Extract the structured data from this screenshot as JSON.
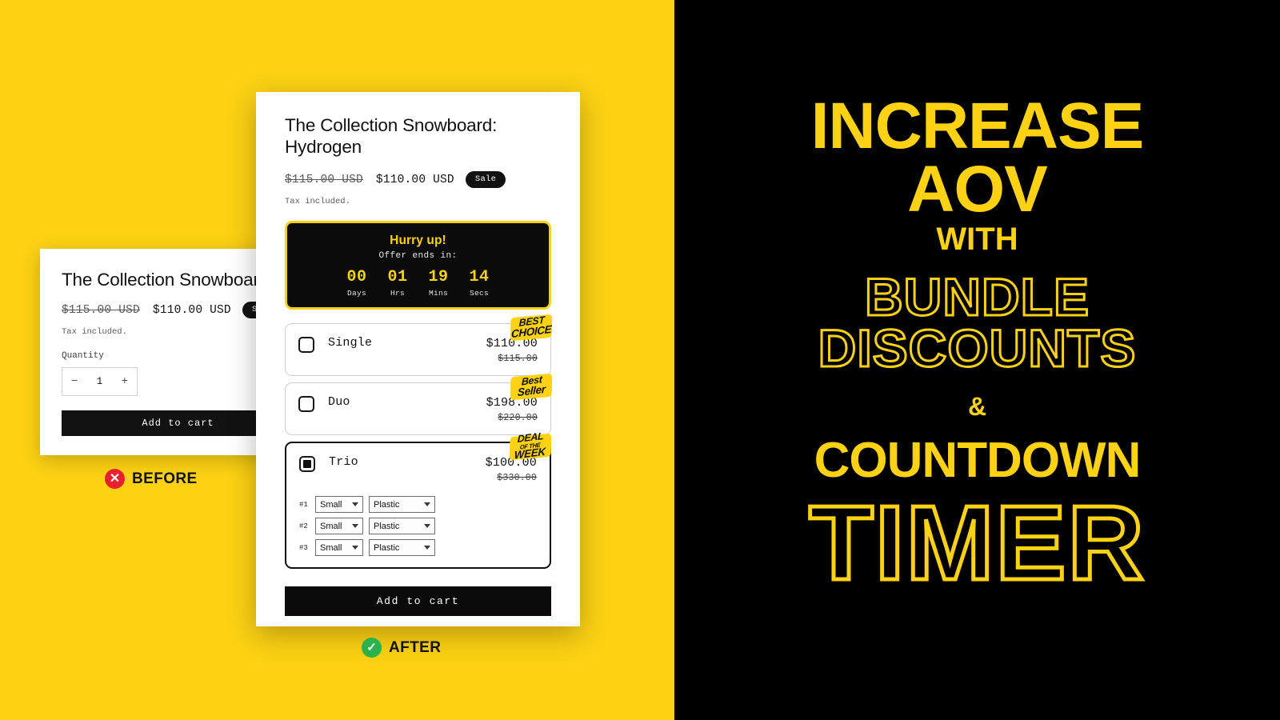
{
  "colors": {
    "brand_yellow": "#FCD213",
    "black": "#000000",
    "white": "#FFFFFF",
    "before_mark_red": "#EA1F2D",
    "after_mark_green": "#2BB24C"
  },
  "labels": {
    "before": {
      "text": "BEFORE",
      "icon": "x-circle-icon",
      "icon_glyph": "✕"
    },
    "after": {
      "text": "AFTER",
      "icon": "check-circle-icon",
      "icon_glyph": "✓"
    }
  },
  "before_card": {
    "product_title": "The Collection Snowboard: Hydrogen",
    "price_compare": "$115.00 USD",
    "price_current": "$110.00 USD",
    "sale_badge": "Sale",
    "tax_note": "Tax included.",
    "quantity_label": "Quantity",
    "quantity_minus": "−",
    "quantity_value": "1",
    "quantity_plus": "+",
    "add_to_cart": "Add to cart"
  },
  "after_card": {
    "product_title": "The Collection Snowboard: Hydrogen",
    "price_compare": "$115.00 USD",
    "price_current": "$110.00 USD",
    "sale_badge": "Sale",
    "tax_note": "Tax included.",
    "countdown": {
      "headline": "Hurry up!",
      "subtitle": "Offer ends in:",
      "units": [
        {
          "value": "00",
          "label": "Days"
        },
        {
          "value": "01",
          "label": "Hrs"
        },
        {
          "value": "19",
          "label": "Mins"
        },
        {
          "value": "14",
          "label": "Secs"
        }
      ]
    },
    "options": [
      {
        "name": "Single",
        "price": "$110.00",
        "compare_at": "$115.00",
        "selected": false,
        "sticker_line1": "BEST",
        "sticker_line2": "CHOICE",
        "sticker_small": ""
      },
      {
        "name": "Duo",
        "price": "$198.00",
        "compare_at": "$220.00",
        "selected": false,
        "sticker_line1": "Best",
        "sticker_line2": "Seller",
        "sticker_small": ""
      },
      {
        "name": "Trio",
        "price": "$100.00",
        "compare_at": "$330.00",
        "selected": true,
        "sticker_line1": "DEAL",
        "sticker_small": "OF THE",
        "sticker_line2": "WEEK"
      }
    ],
    "variant_rows": [
      {
        "index": "#1",
        "size": "Small",
        "material": "Plastic"
      },
      {
        "index": "#2",
        "size": "Small",
        "material": "Plastic"
      },
      {
        "index": "#3",
        "size": "Small",
        "material": "Plastic"
      }
    ],
    "add_to_cart": "Add to cart"
  },
  "promo": {
    "line_increase": "INCREASE",
    "line_aov": "AOV",
    "line_with": "WITH",
    "line_bundle": "BUNDLE",
    "line_discounts": "DISCOUNTS",
    "line_amp": "&",
    "line_countdown": "COUNTDOWN",
    "line_timer": "TIMER"
  }
}
